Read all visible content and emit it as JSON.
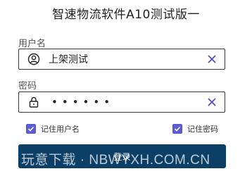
{
  "app": {
    "title": "智速物流软件A10测试版一"
  },
  "username": {
    "label": "用户名",
    "value": "上架测试",
    "icon": "user-circle-icon",
    "clear_icon": "close-icon"
  },
  "password": {
    "label": "密码",
    "masked_value": "••••••",
    "icon": "lock-icon",
    "clear_icon": "close-icon"
  },
  "remember_user": {
    "label": "记住用户名",
    "checked": true
  },
  "remember_password": {
    "label": "记住密码",
    "checked": true
  },
  "login_button": {
    "label": "登录"
  },
  "watermark": {
    "text": "玩意下载 · NBWYXH.COM.CN"
  },
  "colors": {
    "accent": "#5b5bd6",
    "button": "#0c3f66"
  }
}
